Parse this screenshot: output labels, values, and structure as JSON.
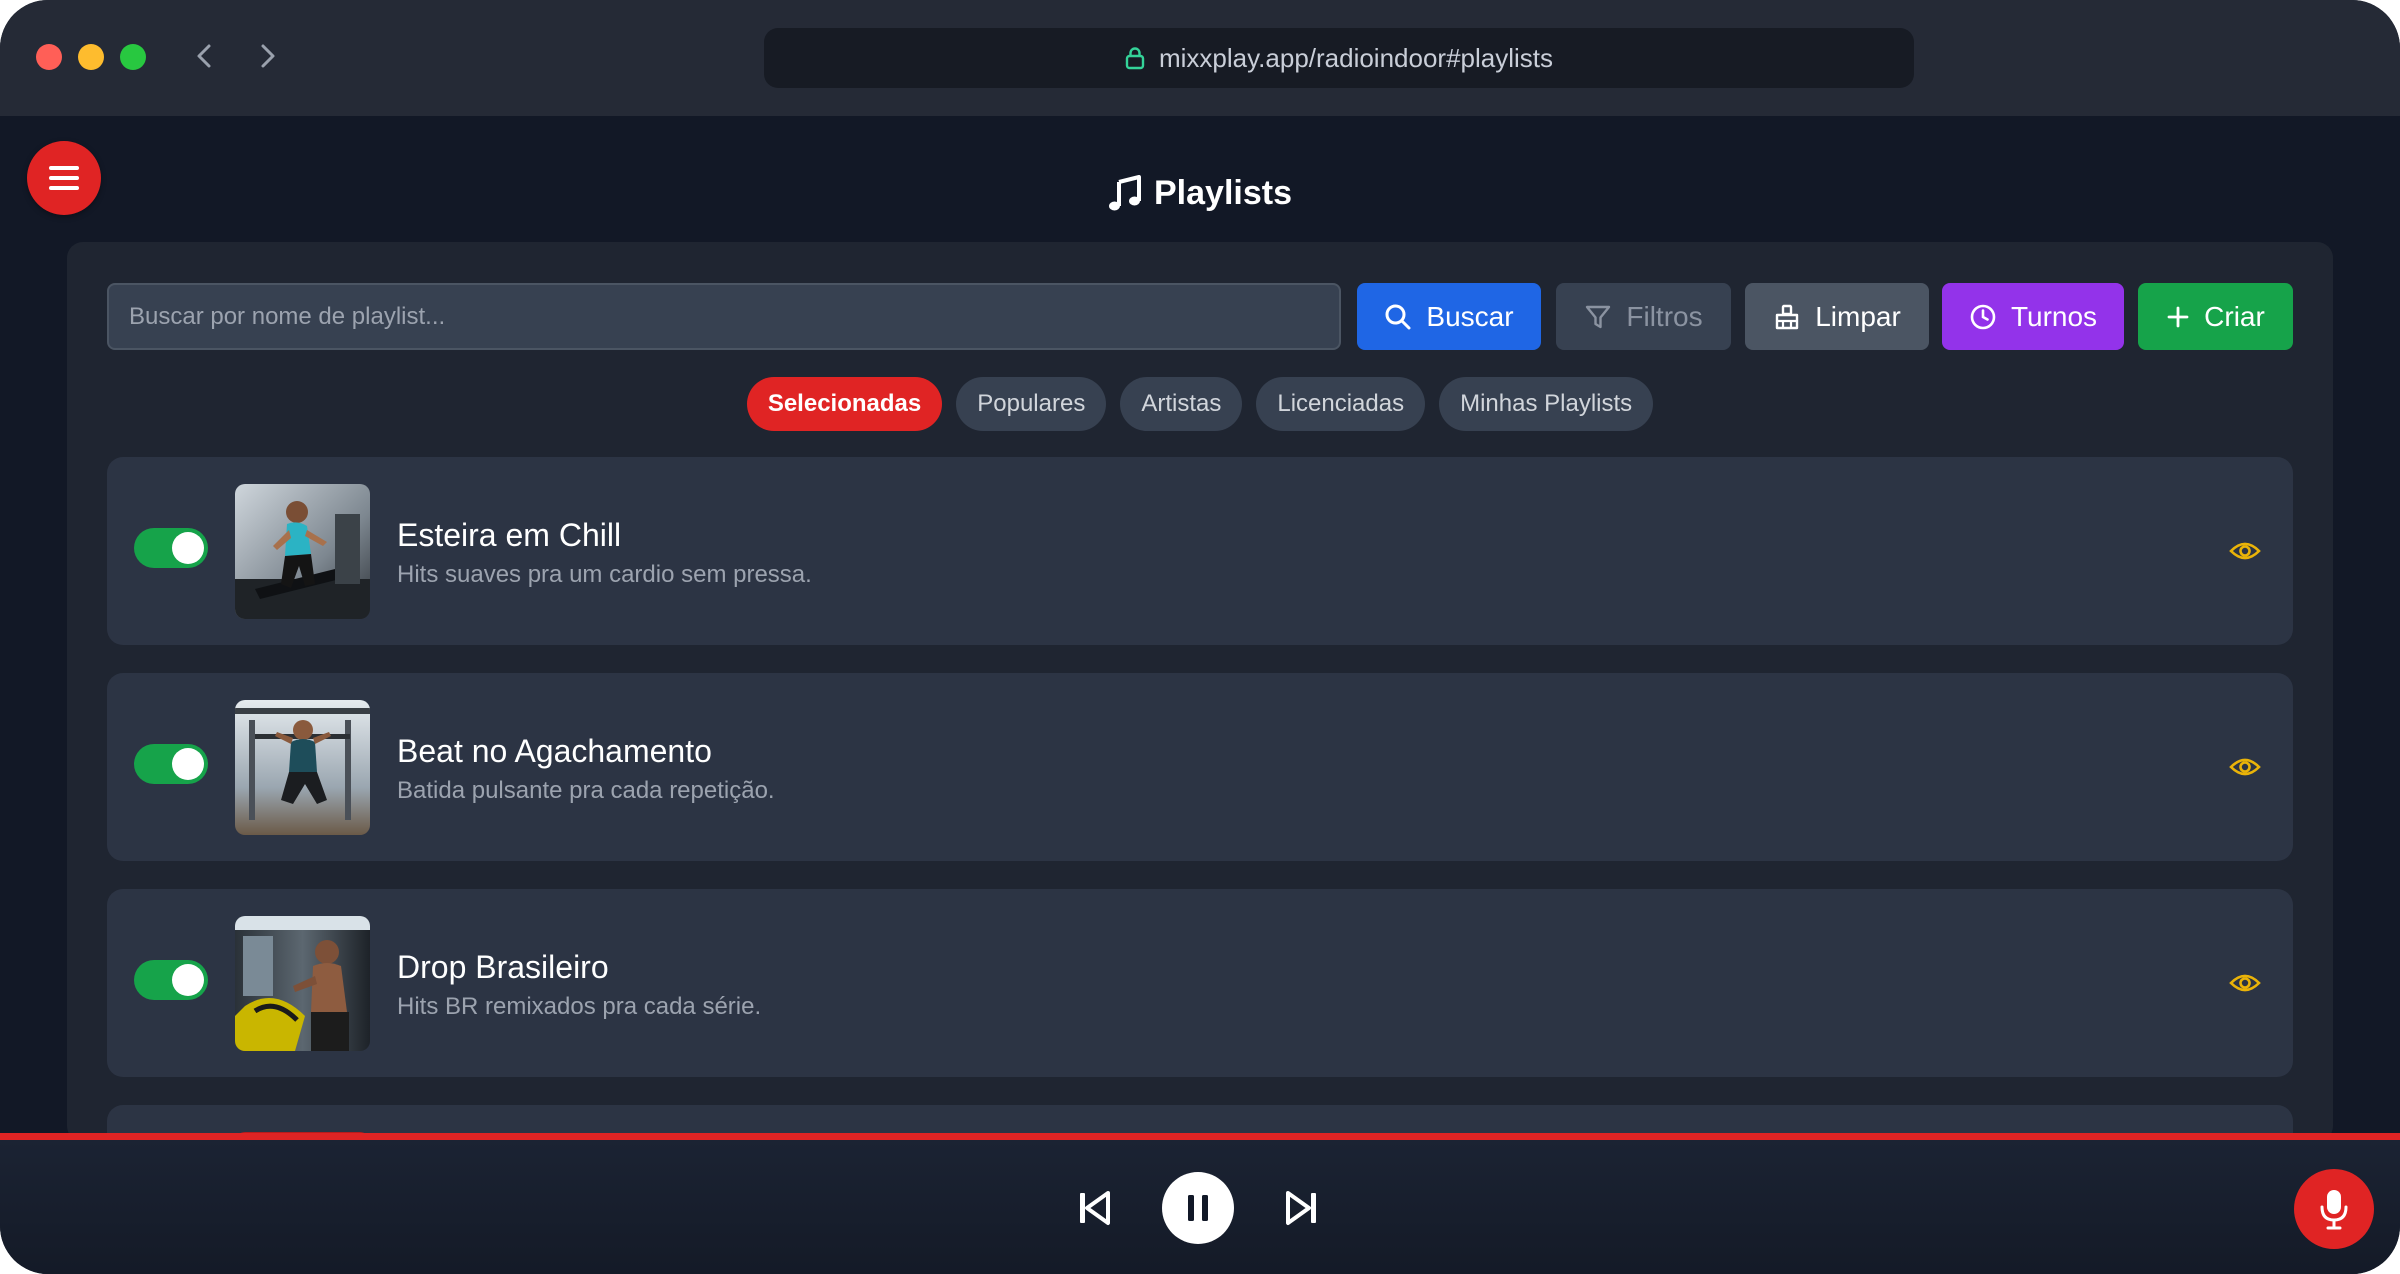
{
  "browser": {
    "url": "mixxplay.app/radioindoor#playlists"
  },
  "page": {
    "title": "Playlists"
  },
  "search": {
    "placeholder": "Buscar por nome de playlist...",
    "value": ""
  },
  "toolbar": {
    "buscar_label": "Buscar",
    "filtros_label": "Filtros",
    "limpar_label": "Limpar",
    "turnos_label": "Turnos",
    "criar_label": "Criar"
  },
  "tabs": [
    {
      "label": "Selecionadas",
      "active": true
    },
    {
      "label": "Populares",
      "active": false
    },
    {
      "label": "Artistas",
      "active": false
    },
    {
      "label": "Licenciadas",
      "active": false
    },
    {
      "label": "Minhas Playlists",
      "active": false
    }
  ],
  "playlists": [
    {
      "title": "Esteira em Chill",
      "description": "Hits suaves pra um cardio sem pressa.",
      "enabled": true
    },
    {
      "title": "Beat no Agachamento",
      "description": "Batida pulsante pra cada repetição.",
      "enabled": true
    },
    {
      "title": "Drop Brasileiro",
      "description": "Hits BR remixados pra cada série.",
      "enabled": true
    }
  ],
  "colors": {
    "accent_red": "#e02424",
    "buscar": "#1f66e5",
    "turnos": "#9333ea",
    "criar": "#16a34a",
    "eye_icon": "#eab308"
  },
  "icons": {
    "menu": "hamburger-icon",
    "title": "music-note-icon",
    "buscar": "search-icon",
    "filtros": "filter-icon",
    "limpar": "broom-icon",
    "turnos": "clock-icon",
    "criar": "plus-icon",
    "view": "eye-icon",
    "player": [
      "skip-back-icon",
      "pause-icon",
      "skip-forward-icon"
    ],
    "mic": "microphone-icon"
  }
}
